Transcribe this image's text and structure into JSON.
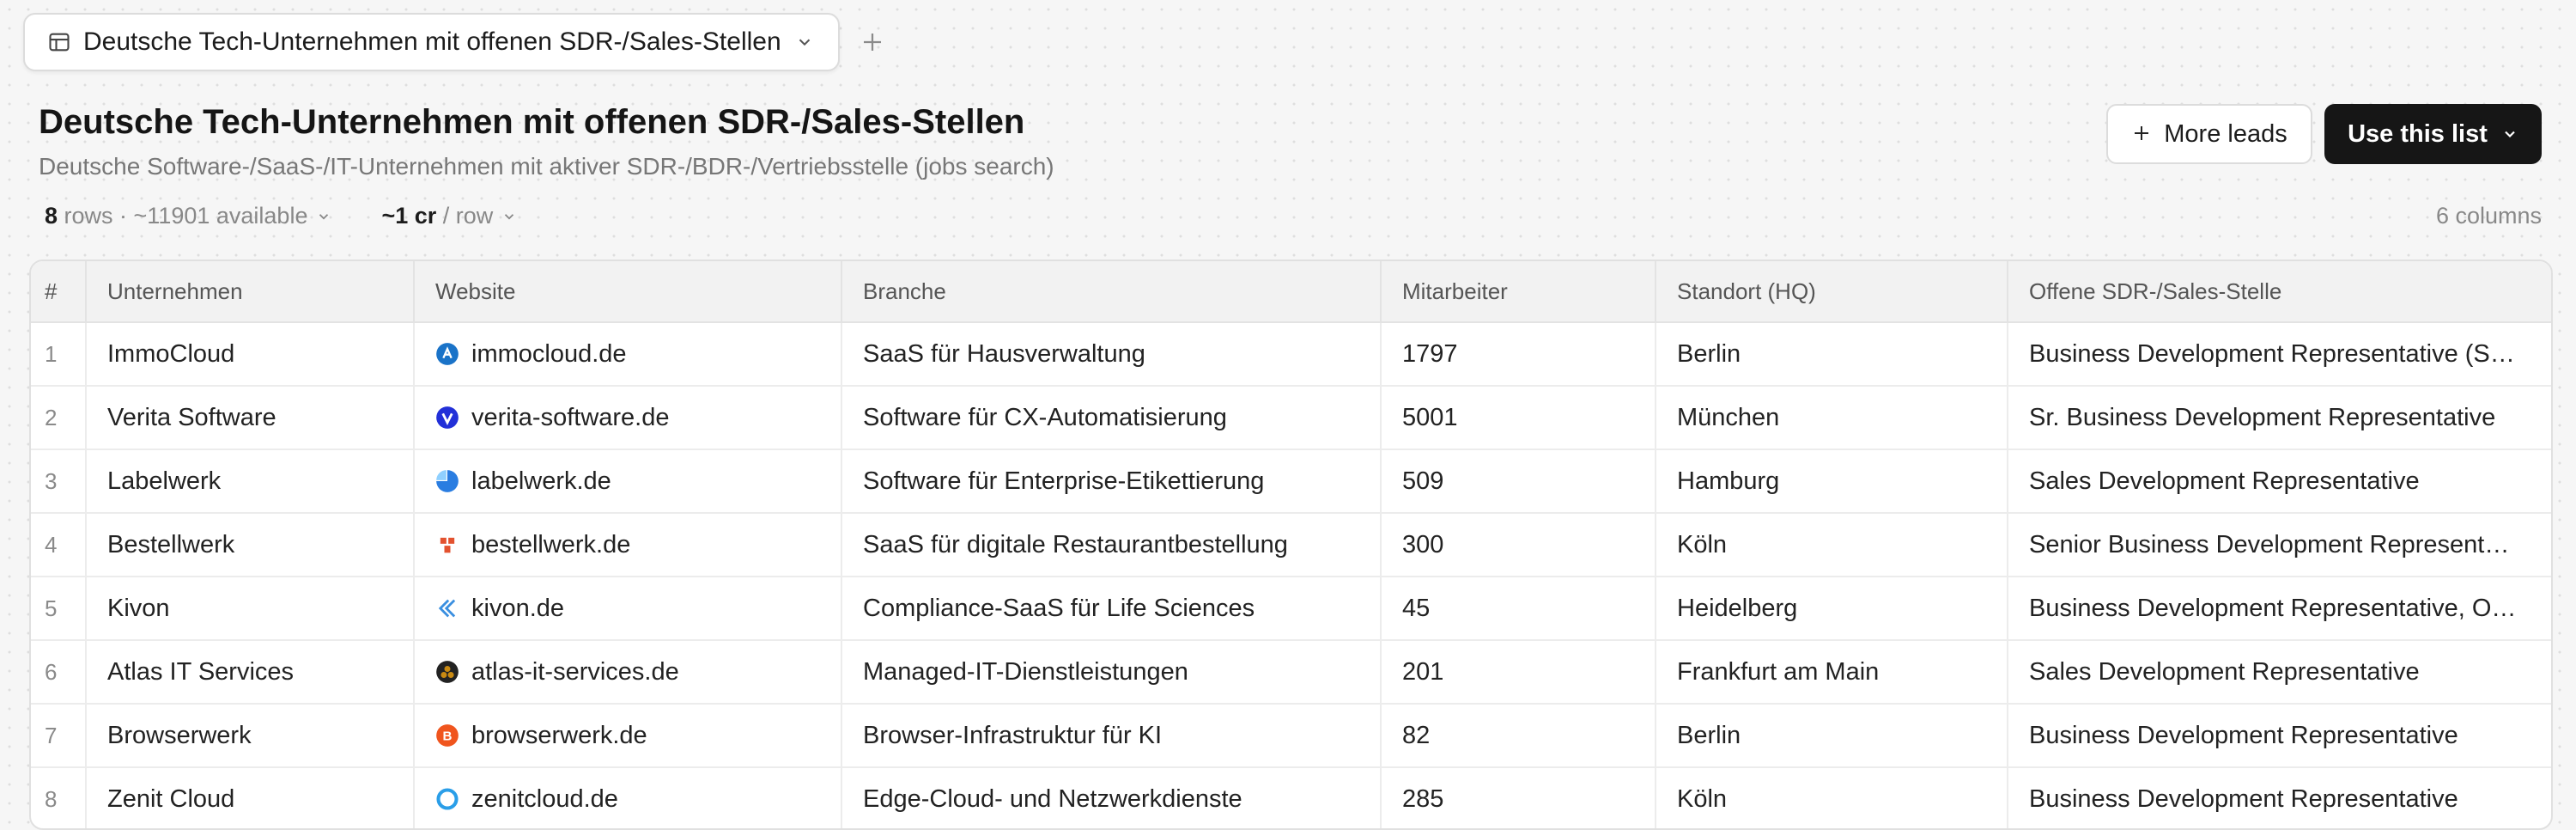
{
  "tab": {
    "title": "Deutsche Tech-Unternehmen mit offenen SDR-/Sales-Stellen",
    "add_label": "+"
  },
  "header": {
    "title": "Deutsche Tech-Unternehmen mit offenen SDR-/Sales-Stellen",
    "subtitle": "Deutsche Software-/SaaS-/IT-Unternehmen mit aktiver SDR-/BDR-/Vertriebsstelle (jobs search)"
  },
  "meta": {
    "rows_count": "8",
    "rows_label": " rows · ~11901 available",
    "cost_value": "~1 cr",
    "cost_label": " / row",
    "columns_label": "6 columns"
  },
  "actions": {
    "more_leads": "More leads",
    "use_list": "Use this list"
  },
  "table": {
    "columns": [
      "#",
      "Unternehmen",
      "Website",
      "Branche",
      "Mitarbeiter",
      "Standort (HQ)",
      "Offene SDR-/Sales-Stelle"
    ],
    "rows": [
      {
        "num": "1",
        "company": "ImmoCloud",
        "website": "immocloud.de",
        "branche": "SaaS für Hausverwaltung",
        "employees": "1797",
        "hq": "Berlin",
        "role": "Business Development Representative (S…",
        "icon": "immocloud-favicon",
        "color": "#1a73c8"
      },
      {
        "num": "2",
        "company": "Verita Software",
        "website": "verita-software.de",
        "branche": "Software für CX-Automatisierung",
        "employees": "5001",
        "hq": "München",
        "role": "Sr. Business Development Representative",
        "icon": "verita-favicon",
        "color": "#2230d8"
      },
      {
        "num": "3",
        "company": "Labelwerk",
        "website": "labelwerk.de",
        "branche": "Software für Enterprise-Etikettierung",
        "employees": "509",
        "hq": "Hamburg",
        "role": "Sales Development Representative",
        "icon": "labelwerk-favicon",
        "color": "#2a7de1"
      },
      {
        "num": "4",
        "company": "Bestellwerk",
        "website": "bestellwerk.de",
        "branche": "SaaS für digitale Restaurantbestellung",
        "employees": "300",
        "hq": "Köln",
        "role": "Senior Business Development Represent…",
        "icon": "bestellwerk-favicon",
        "color": "#e3522f"
      },
      {
        "num": "5",
        "company": "Kivon",
        "website": "kivon.de",
        "branche": "Compliance-SaaS für Life Sciences",
        "employees": "45",
        "hq": "Heidelberg",
        "role": "Business Development Representative, O…",
        "icon": "kivon-favicon",
        "color": "#3a8fe0"
      },
      {
        "num": "6",
        "company": "Atlas IT Services",
        "website": "atlas-it-services.de",
        "branche": "Managed-IT-Dienstleistungen",
        "employees": "201",
        "hq": "Frankfurt am Main",
        "role": "Sales Development Representative",
        "icon": "atlas-favicon",
        "color": "#c98a12"
      },
      {
        "num": "7",
        "company": "Browserwerk",
        "website": "browserwerk.de",
        "branche": "Browser-Infrastruktur für KI",
        "employees": "82",
        "hq": "Berlin",
        "role": "Business Development Representative",
        "icon": "browserwerk-favicon",
        "color": "#f0551e"
      },
      {
        "num": "8",
        "company": "Zenit Cloud",
        "website": "zenitcloud.de",
        "branche": "Edge-Cloud- und Netzwerkdienste",
        "employees": "285",
        "hq": "Köln",
        "role": "Business Development Representative",
        "icon": "zenitcloud-favicon",
        "color": "#2a9ee8"
      }
    ]
  }
}
